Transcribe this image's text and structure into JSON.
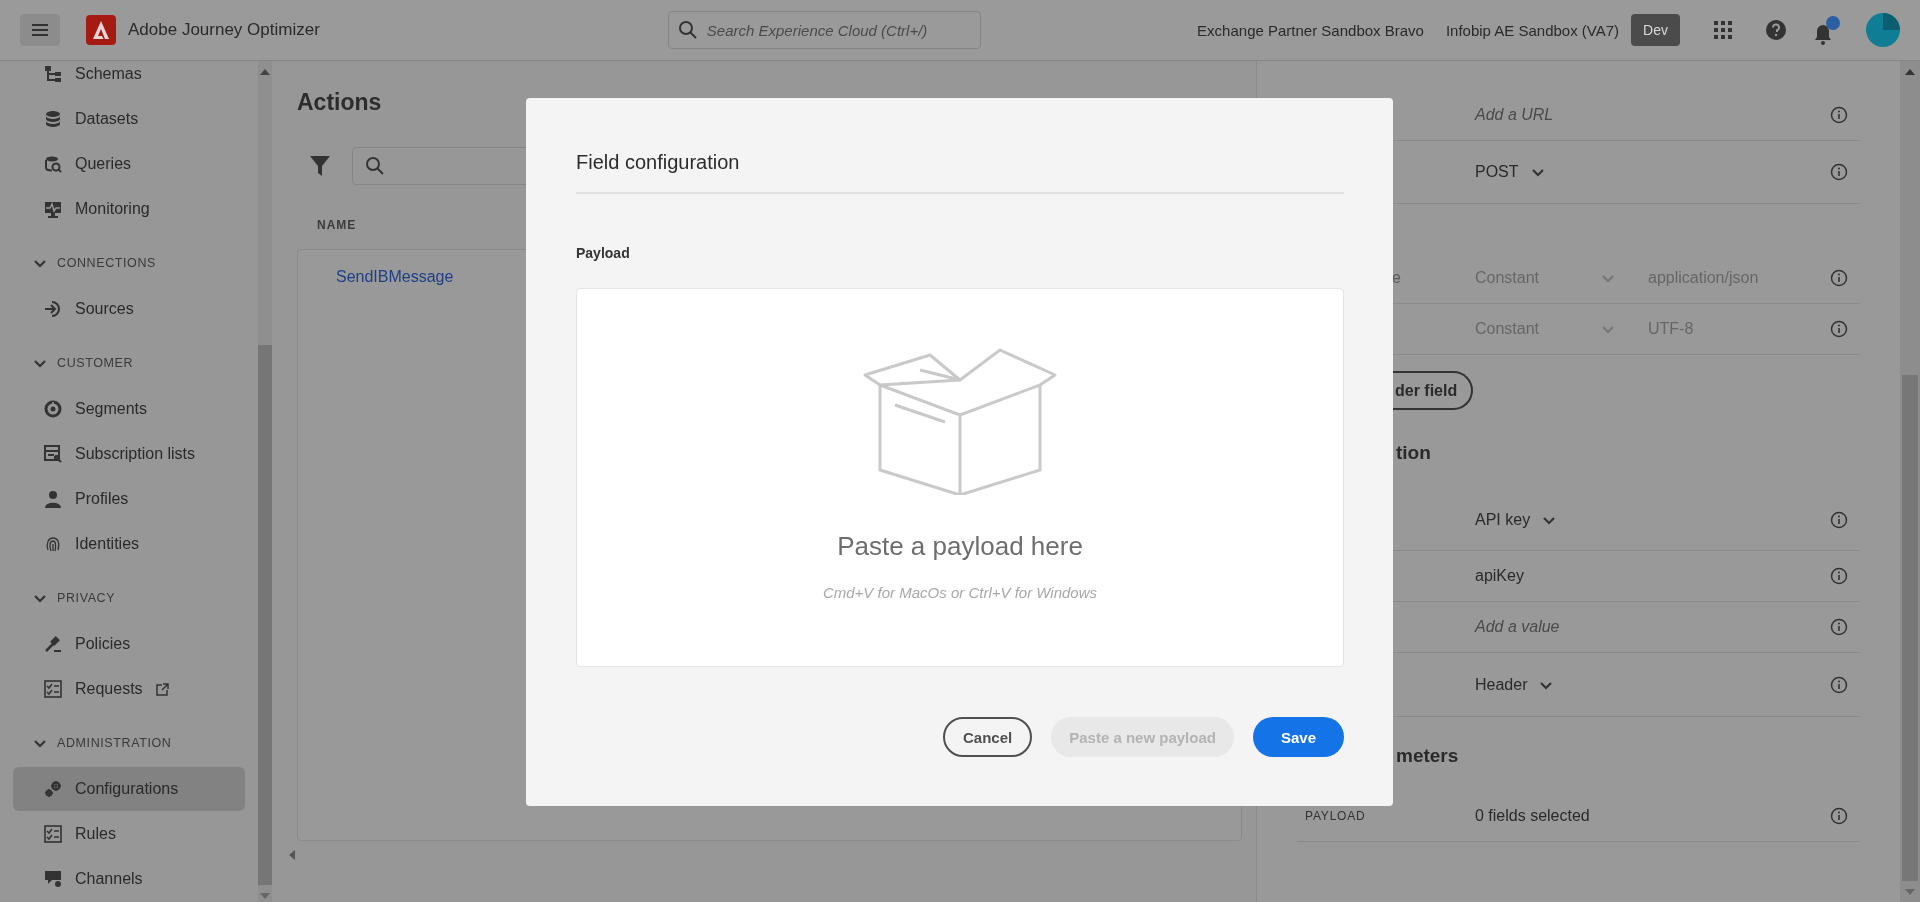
{
  "topbar": {
    "app_name": "Adobe Journey Optimizer",
    "search": {
      "placeholder": "Search Experience Cloud (Ctrl+/)"
    },
    "org": "Exchange Partner Sandbox Bravo",
    "sandbox": "Infobip AE Sandbox (VA7)",
    "env_badge": "Dev",
    "notifications_unread": true
  },
  "sidebar": {
    "items": [
      {
        "kind": "item",
        "label": "Schemas",
        "selected": false
      },
      {
        "kind": "item",
        "label": "Datasets",
        "selected": false
      },
      {
        "kind": "item",
        "label": "Queries",
        "selected": false
      },
      {
        "kind": "item",
        "label": "Monitoring",
        "selected": false
      },
      {
        "kind": "section",
        "label": "CONNECTIONS",
        "expanded": true
      },
      {
        "kind": "item",
        "label": "Sources",
        "selected": false
      },
      {
        "kind": "section",
        "label": "CUSTOMER",
        "expanded": true
      },
      {
        "kind": "item",
        "label": "Segments",
        "selected": false
      },
      {
        "kind": "item",
        "label": "Subscription lists",
        "selected": false
      },
      {
        "kind": "item",
        "label": "Profiles",
        "selected": false
      },
      {
        "kind": "item",
        "label": "Identities",
        "selected": false
      },
      {
        "kind": "section",
        "label": "PRIVACY",
        "expanded": true
      },
      {
        "kind": "item",
        "label": "Policies",
        "selected": false
      },
      {
        "kind": "item",
        "label": "Requests",
        "selected": false,
        "external_link": true
      },
      {
        "kind": "section",
        "label": "ADMINISTRATION",
        "expanded": true
      },
      {
        "kind": "item",
        "label": "Configurations",
        "selected": true
      },
      {
        "kind": "item",
        "label": "Rules",
        "selected": false
      },
      {
        "kind": "item",
        "label": "Channels",
        "selected": false
      }
    ]
  },
  "page": {
    "title": "Actions",
    "table": {
      "columns": [
        "NAME"
      ],
      "rows": [
        {
          "name": "SendIBMessage"
        }
      ]
    }
  },
  "config_panel": {
    "rows": [
      {
        "kind": "input",
        "placeholder": "Add a URL"
      },
      {
        "kind": "dropdown",
        "value": "POST"
      },
      {
        "kind": "header",
        "label": "e",
        "mode": "Constant",
        "value": "application/json",
        "disabled": true
      },
      {
        "kind": "header",
        "mode": "Constant",
        "value": "UTF-8",
        "disabled": true
      },
      {
        "kind": "button",
        "label": "der field"
      },
      {
        "kind": "heading",
        "label": "tion"
      },
      {
        "kind": "dropdown",
        "value": "API key"
      },
      {
        "kind": "input",
        "value": "apiKey"
      },
      {
        "kind": "input",
        "placeholder": "Add a value"
      },
      {
        "kind": "dropdown",
        "value": "Header"
      },
      {
        "kind": "heading",
        "label": "meters"
      },
      {
        "kind": "text",
        "label": "PAYLOAD",
        "value": "0 fields selected"
      }
    ]
  },
  "modal": {
    "title": "Field configuration",
    "section_label": "Payload",
    "dropzone": {
      "title": "Paste a payload here",
      "hint": "Cmd+V for MacOs or Ctrl+V for Windows"
    },
    "buttons": [
      {
        "kind": "outline",
        "label": "Cancel",
        "disabled": false
      },
      {
        "kind": "secondary",
        "label": "Paste a new payload",
        "disabled": true
      },
      {
        "kind": "primary",
        "label": "Save",
        "disabled": false
      }
    ]
  }
}
